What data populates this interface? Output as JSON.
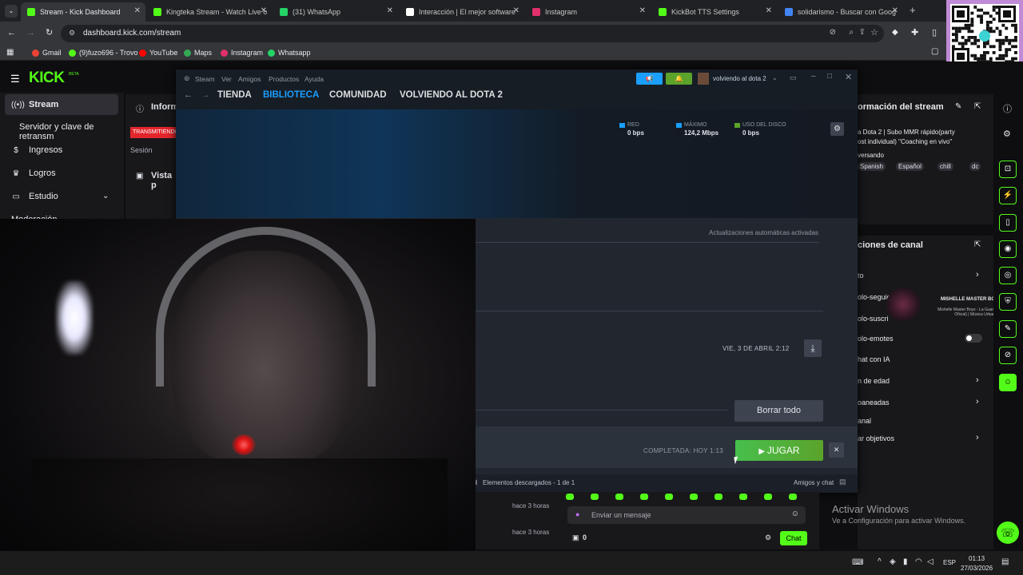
{
  "browser": {
    "tabs": [
      {
        "label": "Stream - Kick Dashboard",
        "active": true,
        "color": "#53fc18"
      },
      {
        "label": "Kingteka Stream - Watch Live o",
        "color": "#53fc18"
      },
      {
        "label": "(31) WhatsApp",
        "color": "#25d366"
      },
      {
        "label": "Interacción | El mejor software",
        "color": "#ffffff"
      },
      {
        "label": "Instagram",
        "color": "#e1306c"
      },
      {
        "label": "KickBot TTS Settings",
        "color": "#53fc18"
      },
      {
        "label": "solidarismo - Buscar con Goog",
        "color": "#4285f4"
      }
    ],
    "url": "dashboard.kick.com/stream",
    "bookmarks": [
      "Gmail",
      "(9)fuzo696 - Trovo",
      "YouTube",
      "Maps",
      "Instagram",
      "Whatsapp"
    ]
  },
  "kick": {
    "logo": "KICK",
    "logo_sup": "BETA",
    "nav": [
      {
        "label": "Stream",
        "icon": "antenna-icon"
      },
      {
        "label": "Servidor y clave de retransm",
        "icon": ""
      },
      {
        "label": "Ingresos",
        "icon": "dollar-icon"
      },
      {
        "label": "Logros",
        "icon": "trophy-icon"
      },
      {
        "label": "Estudio",
        "icon": "monitor-icon"
      },
      {
        "label": "Moderación",
        "icon": ""
      }
    ],
    "info_label": "Inform",
    "live_badge": "TRANSMITIENDO",
    "session_label": "Sesión",
    "preview_label": "Vista p",
    "stream_info_title": "ormación del stream",
    "stream_title": "a Dota 2 | Subo MMR rápido(party",
    "stream_title2": "ost individual) \"Coaching en vivo\"",
    "stream_subtitle": "versando",
    "tags": [
      "Spanish",
      "Español",
      "chill",
      "dc"
    ],
    "channel_actions_title": "ciones de canal",
    "channel_rows": [
      "to",
      "olo-seguid",
      "olo-suscri",
      "olo-emotes",
      "hat con IA",
      "n de edad",
      "oaneadas",
      "anal",
      "ar objetivos"
    ],
    "chat_times": [
      "hace 3 horas",
      "hace 3 horas"
    ],
    "chat_placeholder": "Enviar un mensaje",
    "chat_count": "0",
    "chat_button": "Chat",
    "music_title": "MISHELLE MASTER BOYS",
    "music_sub": "Mishelle Master Boys - La Guarrona (Video Oficial) | Música Urbana"
  },
  "steam": {
    "menu": [
      "Steam",
      "Ver",
      "Amigos",
      "Productos",
      "Ayuda"
    ],
    "user": "volviendo al dota 2",
    "nav": [
      "TIENDA",
      "BIBLIOTECA",
      "COMUNIDAD",
      "VOLVIENDO AL DOTA 2"
    ],
    "active_nav": "BIBLIOTECA",
    "stats": [
      {
        "label": "RED",
        "value": "0 bps"
      },
      {
        "label": "MÁXIMO",
        "value": "124,2 Mbps"
      },
      {
        "label": "USO DEL DISCO",
        "value": "0 bps"
      }
    ],
    "auto_updates": "Actualizaciones automáticas activadas",
    "scheduled": "VIE, 3 DE ABRIL 2:12",
    "clear_all": "Borrar todo",
    "completed": "COMPLETADA: HOY 1:13",
    "play": "JUGAR",
    "footer_left": "Elementos descargados - 1 de 1",
    "footer_right": "Amigos y chat"
  },
  "windows": {
    "activate_title": "Activar Windows",
    "activate_sub": "Ve a Configuración para activar Windows.",
    "time": "01:13",
    "date": "27/03/2026",
    "lang": "ESP"
  },
  "colors": {
    "kick_green": "#53fc18",
    "steam_blue": "#1a9fff",
    "play_green": "#5ba32b"
  }
}
